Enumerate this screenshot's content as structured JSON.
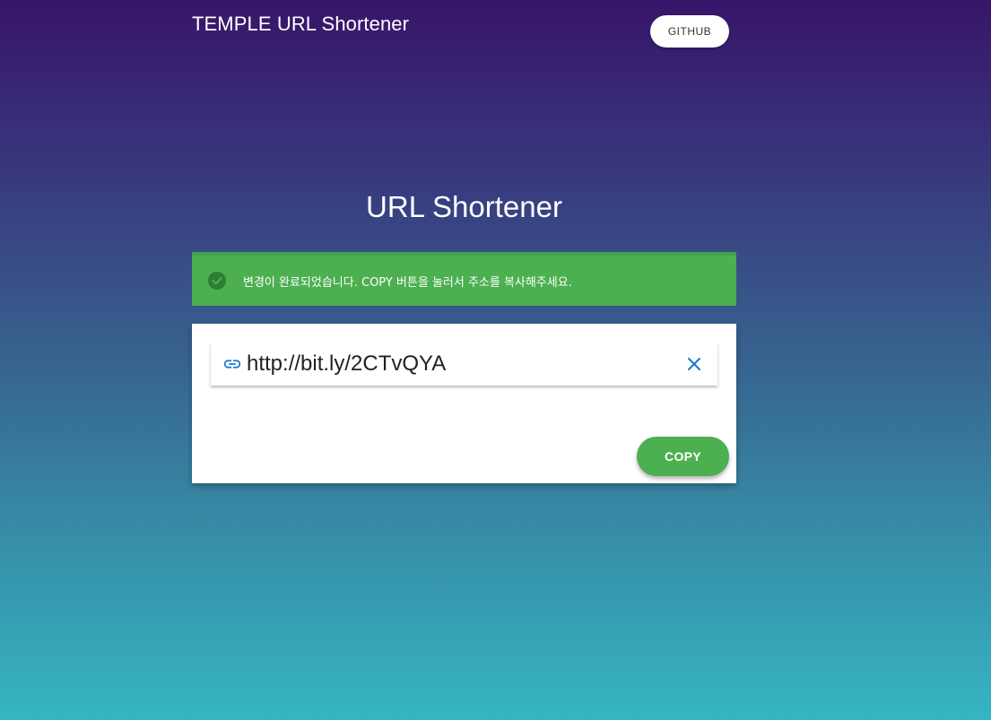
{
  "header": {
    "title": "TEMPLE URL Shortener",
    "github_label": "GITHUB"
  },
  "main": {
    "heading": "URL Shortener"
  },
  "alert": {
    "icon": "check-circle-icon",
    "message": "변경이 완료되었습니다. COPY 버튼을 눌러서 주소를 복사해주세요.",
    "color": "#4caf50"
  },
  "card": {
    "url_field": {
      "icon": "link-icon",
      "value": "http://bit.ly/2CTvQYA",
      "clear_icon": "close-icon"
    },
    "copy_label": "COPY"
  },
  "colors": {
    "accent_green": "#4caf50",
    "icon_blue": "#1976d2",
    "gradient_top": "#38156a",
    "gradient_bottom": "#35b5c2"
  }
}
